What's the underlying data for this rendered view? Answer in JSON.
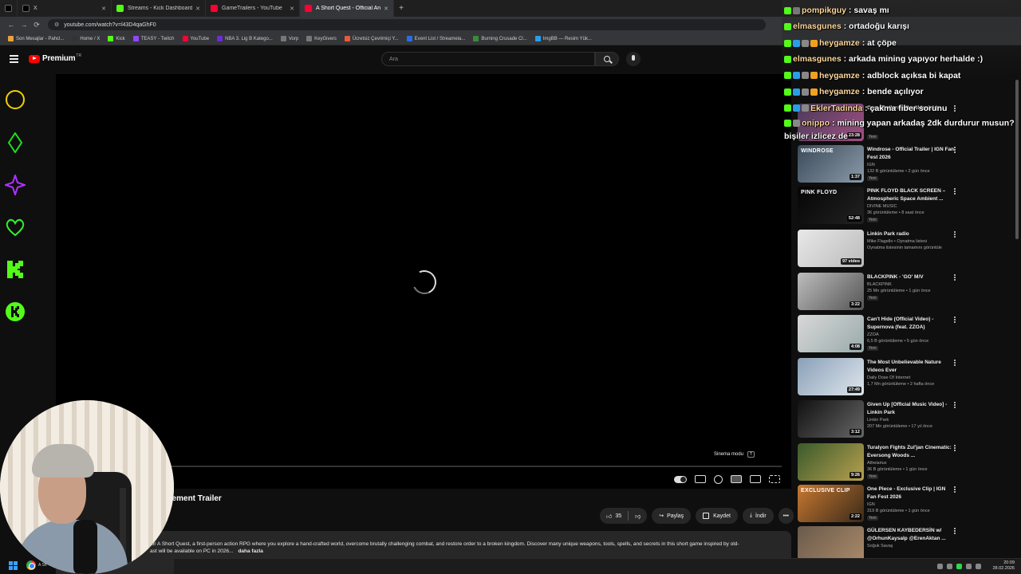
{
  "browser": {
    "tabs": [
      {
        "label": "X",
        "color": "#1d1d1d"
      },
      {
        "label": "X",
        "color": "#1d1d1d"
      },
      {
        "label": "Streams - Kick Dashboard",
        "color": "#53fc18"
      },
      {
        "label": "GameTrailers - YouTube",
        "color": "#ff0033"
      },
      {
        "label": "A Short Quest - Official Annou",
        "color": "#ff0033"
      }
    ],
    "url": "youtube.com/watch?v=l43D4qaGhF0",
    "bookmarks": [
      {
        "label": "Son Mesajlar - Pahcl...",
        "color": "#e8a23a"
      },
      {
        "label": "Home / X",
        "color": "#333"
      },
      {
        "label": "Kick",
        "color": "#53fc18"
      },
      {
        "label": "TEASY - Twitch",
        "color": "#9146ff"
      },
      {
        "label": "YouTube",
        "color": "#ff0033"
      },
      {
        "label": "NBA 3. Lig B Katego...",
        "color": "#6d2bd9"
      },
      {
        "label": "Vorp",
        "color": "#777"
      },
      {
        "label": "KeyGivers",
        "color": "#777"
      },
      {
        "label": "Ücretsiz Çevrimiçi Y...",
        "color": "#e85a3a"
      },
      {
        "label": "Event List / Streamela...",
        "color": "#2b6de8"
      },
      {
        "label": "Burning Crusade Cl...",
        "color": "#3a8a3a"
      },
      {
        "label": "ImgBB — Resim Yük...",
        "color": "#2b9de8"
      }
    ]
  },
  "youtube": {
    "logo_text": "Premium",
    "logo_sup": "TR",
    "search_placeholder": "Ara",
    "cinema_tip": "Sinema modu",
    "cinema_key": "T",
    "video_title_visible": "cement Trailer",
    "likes": "35",
    "share": "Paylaş",
    "save": "Kaydet",
    "download": "İndir",
    "description": "for A Short Quest, a first-person action RPG where you explore a hand-crafted world, overcome brutally challenging combat, and restore order to a broken kingdom. Discover many unique weapons, tools, spells, and secrets in this short game inspired by old-",
    "description_line2": "ast will be available on PC in 2026...",
    "more": "daha fazla"
  },
  "recommendations": [
    {
      "title": "GameTrailers adlı yüklenicide",
      "channel": "",
      "meta": "",
      "duration": "23:28",
      "badge": "Yeni",
      "color1": "#4a3a5a",
      "color2": "#a05080",
      "label": ""
    },
    {
      "title": "Windrose - Official Trailer | IGN Fan Fest 2026",
      "channel": "IGN",
      "meta": "132 B görüntüleme • 2 gün önce",
      "duration": "1:37",
      "badge": "Yeni",
      "color1": "#3a4a5a",
      "color2": "#8a9aa8",
      "label": "WINDROSE"
    },
    {
      "title": "PINK FLOYD BLACK SCREEN – Atmospheric Space Ambient ...",
      "channel": "DIVINE MUSIC",
      "meta": "36 görüntüleme • 8 saat önce",
      "duration": "52:48",
      "badge": "Yeni",
      "color1": "#050505",
      "color2": "#222",
      "label": "PINK FLOYD"
    },
    {
      "title": "Linkin Park radio",
      "channel": "Mike Flagello • Oynatma listesi",
      "meta": "Oynatma listesinin tamamını görüntüle",
      "duration": "97 video",
      "badge": "",
      "color1": "#e8e8e8",
      "color2": "#bbb",
      "label": ""
    },
    {
      "title": "BLACKPINK - 'GO' M/V",
      "channel": "BLACKPINK",
      "meta": "25 Mn görüntüleme • 1 gün önce",
      "duration": "3:22",
      "badge": "Yeni",
      "color1": "#bdbdbd",
      "color2": "#555",
      "label": ""
    },
    {
      "title": "Can't Hide (Official Video) - Supernova (feat. ZZOA)",
      "channel": "ZZOA",
      "meta": "6,5 B görüntüleme • 5 gün önce",
      "duration": "4:08",
      "badge": "Yeni",
      "color1": "#d8d8d8",
      "color2": "#9aa",
      "label": ""
    },
    {
      "title": "The Most Unbelievable Nature Videos Ever",
      "channel": "Daily Dose Of Internet",
      "meta": "1,7 Mn görüntüleme • 2 hafta önce",
      "duration": "27:49",
      "badge": "",
      "color1": "#8aa0b8",
      "color2": "#dfe6ec",
      "label": ""
    },
    {
      "title": "Given Up [Official Music Video] - Linkin Park",
      "channel": "Linkin Park",
      "meta": "207 Mn görüntüleme • 17 yıl önce",
      "duration": "3:12",
      "badge": "",
      "color1": "#111",
      "color2": "#666",
      "label": ""
    },
    {
      "title": "Turalyon Fights Zul'jan Cinematic: Eversong Woods ...",
      "channel": "Atheiarius",
      "meta": "36 B görüntüleme • 1 gün önce",
      "duration": "9:26",
      "badge": "Yeni",
      "color1": "#3a5a2a",
      "color2": "#b8a050",
      "label": ""
    },
    {
      "title": "One Piece - Exclusive Clip | IGN Fan Fest 2026",
      "channel": "IGN",
      "meta": "319 B görüntüleme • 1 gün önce",
      "duration": "2:22",
      "badge": "Yeni",
      "color1": "#c87830",
      "color2": "#3a2a1a",
      "label": "EXCLUSIVE CLIP"
    },
    {
      "title": "GÜLERSEN KAYBEDERSİN w/ @OrhunKaysalp @ErenAktan ...",
      "channel": "Soğuk Savaş",
      "meta": "",
      "duration": "",
      "badge": "",
      "color1": "#6a5a4a",
      "color2": "#aa8a6a",
      "label": ""
    }
  ],
  "chat": [
    {
      "user": "pompikguy",
      "text": "savaş mı",
      "badges": [
        "#53fc18",
        "#777"
      ]
    },
    {
      "user": "elmasgunes",
      "text": "ortadoğu karışı",
      "badges": [
        "#53fc18"
      ]
    },
    {
      "user": "heygamze",
      "text": "at çöpe",
      "badges": [
        "#53fc18",
        "#2b9de8",
        "#888",
        "#f0a020"
      ]
    },
    {
      "user": "elmasgunes",
      "text": "arkada mining yapıyor herhalde :)",
      "badges": [
        "#53fc18"
      ]
    },
    {
      "user": "heygamze",
      "text": "adblock açıksa bi kapat",
      "badges": [
        "#53fc18",
        "#2b9de8",
        "#888",
        "#f0a020"
      ]
    },
    {
      "user": "heygamze",
      "text": "bende açılıyor",
      "badges": [
        "#53fc18",
        "#2b9de8",
        "#888",
        "#f0a020"
      ]
    },
    {
      "user": "EklerTadinda",
      "text": "çakma fiber sorunu",
      "badges": [
        "#53fc18",
        "#2b9de8",
        "#888"
      ]
    },
    {
      "user": "onippo",
      "text": "mining yapan arkadaş 2dk durdurur musun? bişiler izlicez de",
      "badges": [
        "#53fc18",
        "#888"
      ]
    }
  ],
  "taskbar": {
    "app_label": "A Sh",
    "time": "20:09",
    "date": "28.02.2026"
  },
  "side_icon_colors": [
    "#f0d000",
    "#1de01d",
    "#b030ff",
    "#30f030",
    "#53fc18",
    "#53fc18"
  ]
}
